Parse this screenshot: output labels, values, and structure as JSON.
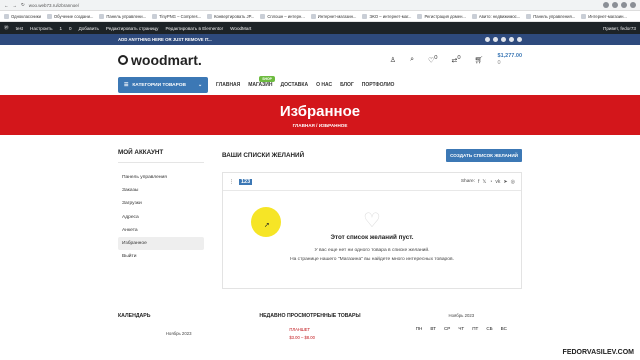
{
  "browser": {
    "url": "woo.web73.ru/izbrannoe/",
    "bookmarks": [
      "Одноклассники",
      "Обучение создани...",
      "Панель управлени...",
      "TinyPNG – Compres...",
      "Конвертировать JP...",
      "Сплошн – интерн...",
      "Интернет-магазин...",
      "ЭКО – интернет-маг...",
      "Регистрация домен...",
      "Авито: недвижимос...",
      "Панель управления...",
      "Интернет-магазин..."
    ]
  },
  "wp_admin_bar": {
    "items": [
      "test",
      "Настроить",
      "1",
      "0",
      "Добавить",
      "Редактировать страницу",
      "Редактировать в Elementor",
      "WoodMart"
    ],
    "greeting": "Привет, fedor73"
  },
  "promo": {
    "text": "ADD ANYTHING HERE OR JUST REMOVE IT..."
  },
  "header": {
    "logo": "woodmart.",
    "wishlist_count": "0",
    "compare_count": "0",
    "cart_total": "$1,277.00",
    "cart_count": "0"
  },
  "nav": {
    "categories_label": "КАТЕГОРИИ ТОВАРОВ",
    "items": [
      "ГЛАВНАЯ",
      "МАГАЗИН",
      "ДОСТАВКА",
      "О НАС",
      "БЛОГ",
      "ПОРТФОЛИО"
    ],
    "shop_badge": "SHOP"
  },
  "hero": {
    "title": "Избранное",
    "crumb_home": "ГЛАВНАЯ",
    "crumb_sep": "/",
    "crumb_current": "ИЗБРАННОЕ"
  },
  "account": {
    "title": "МОЙ АККАУНТ",
    "items": [
      "Панель управления",
      "Заказы",
      "Загрузки",
      "Адреса",
      "Анкета",
      "Избранное",
      "Выйти"
    ]
  },
  "wishlists": {
    "title": "ВАШИ СПИСКИ ЖЕЛАНИЙ",
    "create_label": "СОЗДАТЬ СПИСОК ЖЕЛАНИЙ",
    "list_name": "123",
    "share_label": "Share:",
    "empty_title": "Этот список желаний пуст.",
    "empty_line1": "У вас еще нет ни одного товара в списке желаний.",
    "empty_line2": "На странице нашего \"Магазина\" вы найдете много интересных товаров."
  },
  "footer": {
    "calendar_title": "КАЛЕНДАРЬ",
    "calendar_month": "Ноябрь 2023",
    "recent_title": "НЕДАВНО ПРОСМОТРЕННЫЕ ТОВАРЫ",
    "recent_item": "ПЛАНШЕТ",
    "recent_price": "$3.00 – $8.00",
    "calendar2_month": "Ноябрь 2023",
    "weekdays": [
      "ПН",
      "ВТ",
      "СР",
      "ЧТ",
      "ПТ",
      "СБ",
      "ВС"
    ]
  },
  "watermark": "FEDORVASILEV.COM"
}
